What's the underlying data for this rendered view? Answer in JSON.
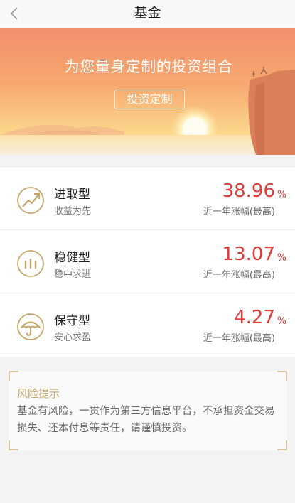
{
  "nav": {
    "title": "基金",
    "back_icon": "chevron-left-icon"
  },
  "banner": {
    "headline": "为您量身定制的投资组合",
    "cta": "投资定制"
  },
  "funds": [
    {
      "name": "进取型",
      "sub": "收益为先",
      "rate": "38.96",
      "unit": "%",
      "rate_label": "近一年涨幅(最高)",
      "icon": "trend-up-icon"
    },
    {
      "name": "稳健型",
      "sub": "稳中求进",
      "rate": "13.07",
      "unit": "%",
      "rate_label": "近一年涨幅(最高)",
      "icon": "bars-circle-icon"
    },
    {
      "name": "保守型",
      "sub": "安心求盈",
      "rate": "4.27",
      "unit": "%",
      "rate_label": "近一年涨幅(最高)",
      "icon": "umbrella-icon"
    }
  ],
  "risk": {
    "title": "风险提示",
    "body": "基金有风险，一贯作为第三方信息平台，不承担资金交易损失、还本付息等责任，请谨慎投资。"
  },
  "colors": {
    "accent_red": "#e13b3b",
    "gold": "#c7a66a",
    "risk_title": "#c1a56c"
  }
}
